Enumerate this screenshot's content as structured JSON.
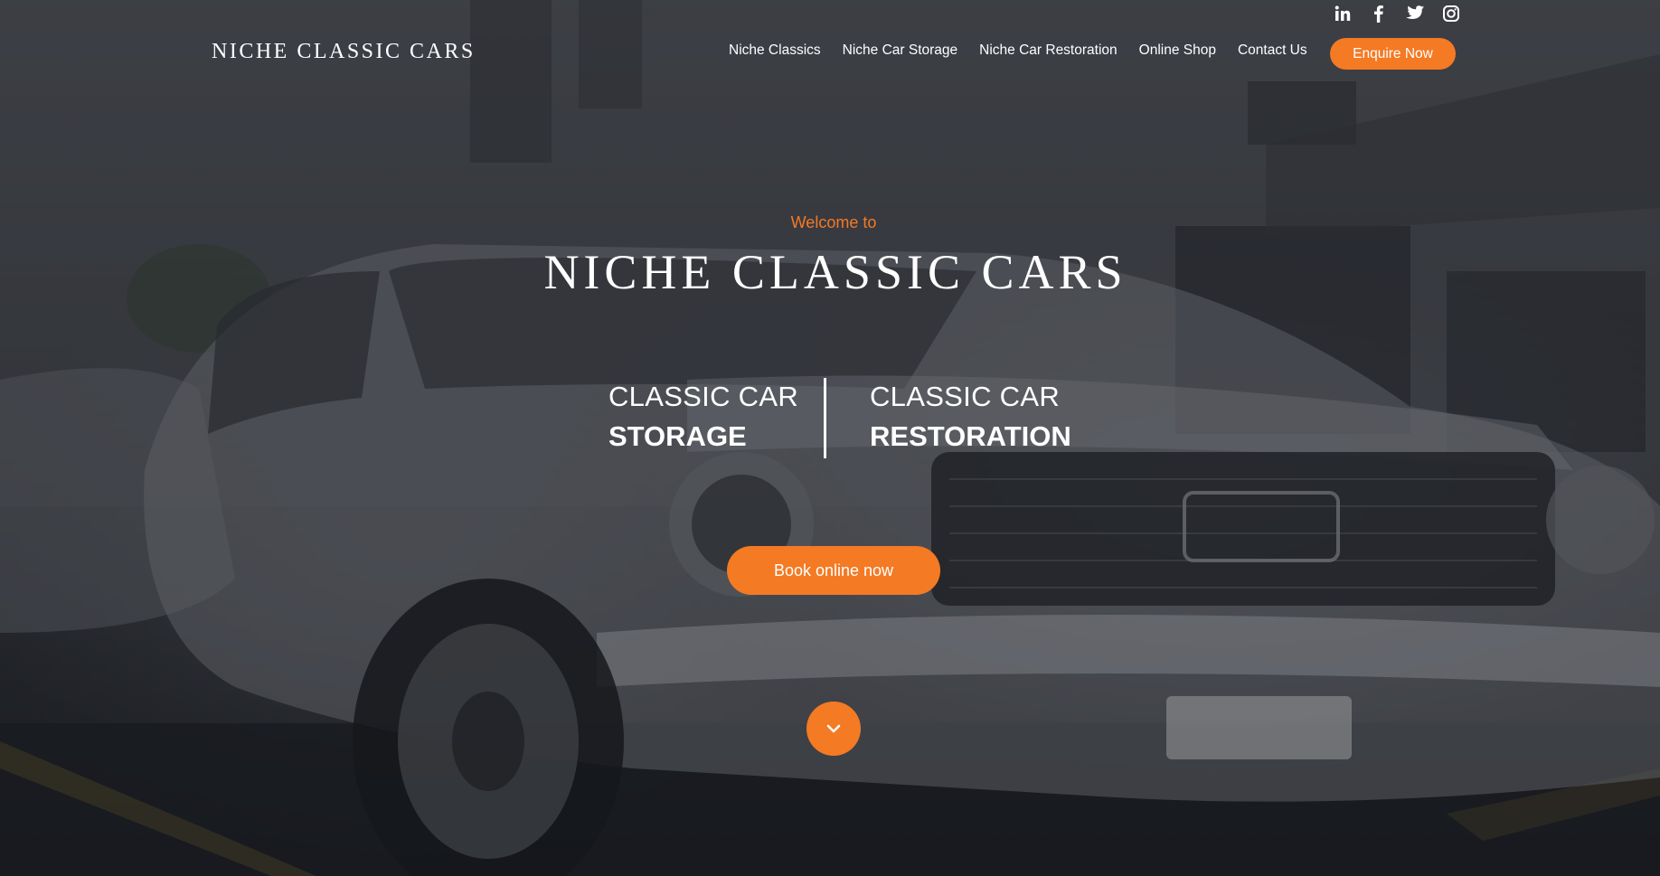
{
  "brand": {
    "name": "NICHE CLASSIC CARS"
  },
  "social": [
    {
      "icon": "linkedin-icon"
    },
    {
      "icon": "facebook-icon"
    },
    {
      "icon": "twitter-icon"
    },
    {
      "icon": "instagram-icon"
    }
  ],
  "nav": {
    "items": [
      {
        "label": "Niche Classics"
      },
      {
        "label": "Niche Car Storage"
      },
      {
        "label": "Niche Car Restoration"
      },
      {
        "label": "Online Shop"
      },
      {
        "label": "Contact Us"
      }
    ],
    "cta_label": "Enquire Now"
  },
  "hero": {
    "welcome": "Welcome to",
    "title": "NICHE CLASSIC CARS",
    "services": [
      {
        "line1": "CLASSIC CAR",
        "line2": "STORAGE"
      },
      {
        "line1": "CLASSIC CAR",
        "line2": "RESTORATION"
      }
    ],
    "book_label": "Book online now",
    "scroll_icon": "chevron-down-icon"
  },
  "colors": {
    "accent": "#f47a24",
    "text": "#ffffff"
  }
}
